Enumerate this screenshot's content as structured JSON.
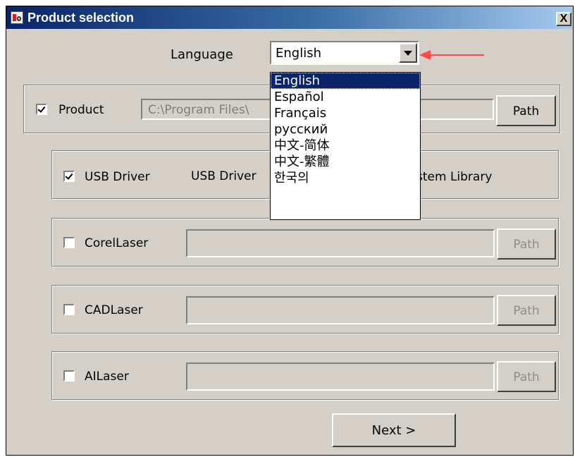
{
  "window": {
    "title": "Product selection",
    "close_label": "X"
  },
  "language": {
    "label": "Language",
    "value": "English",
    "options": [
      "English",
      "Español",
      "Français",
      "русский",
      "中文-简体",
      "中文-繁體",
      "한국의"
    ],
    "selected_index": 0
  },
  "annotation_arrow_color": "#ff4a4a",
  "product": {
    "label": "Product",
    "checked": true,
    "path": "C:\\Program Files\\",
    "button": "Path"
  },
  "usb": {
    "checkbox_label": "USB Driver",
    "driver_text": "USB Driver",
    "library_text": "stem Library",
    "checked": true
  },
  "corel": {
    "label": "CorelLaser",
    "checked": false,
    "path": "",
    "button": "Path",
    "enabled": false
  },
  "cad": {
    "label": "CADLaser",
    "checked": false,
    "path": "",
    "button": "Path",
    "enabled": false
  },
  "ai": {
    "label": "AILaser",
    "checked": false,
    "path": "",
    "button": "Path",
    "enabled": false
  },
  "next_button": "Next >"
}
